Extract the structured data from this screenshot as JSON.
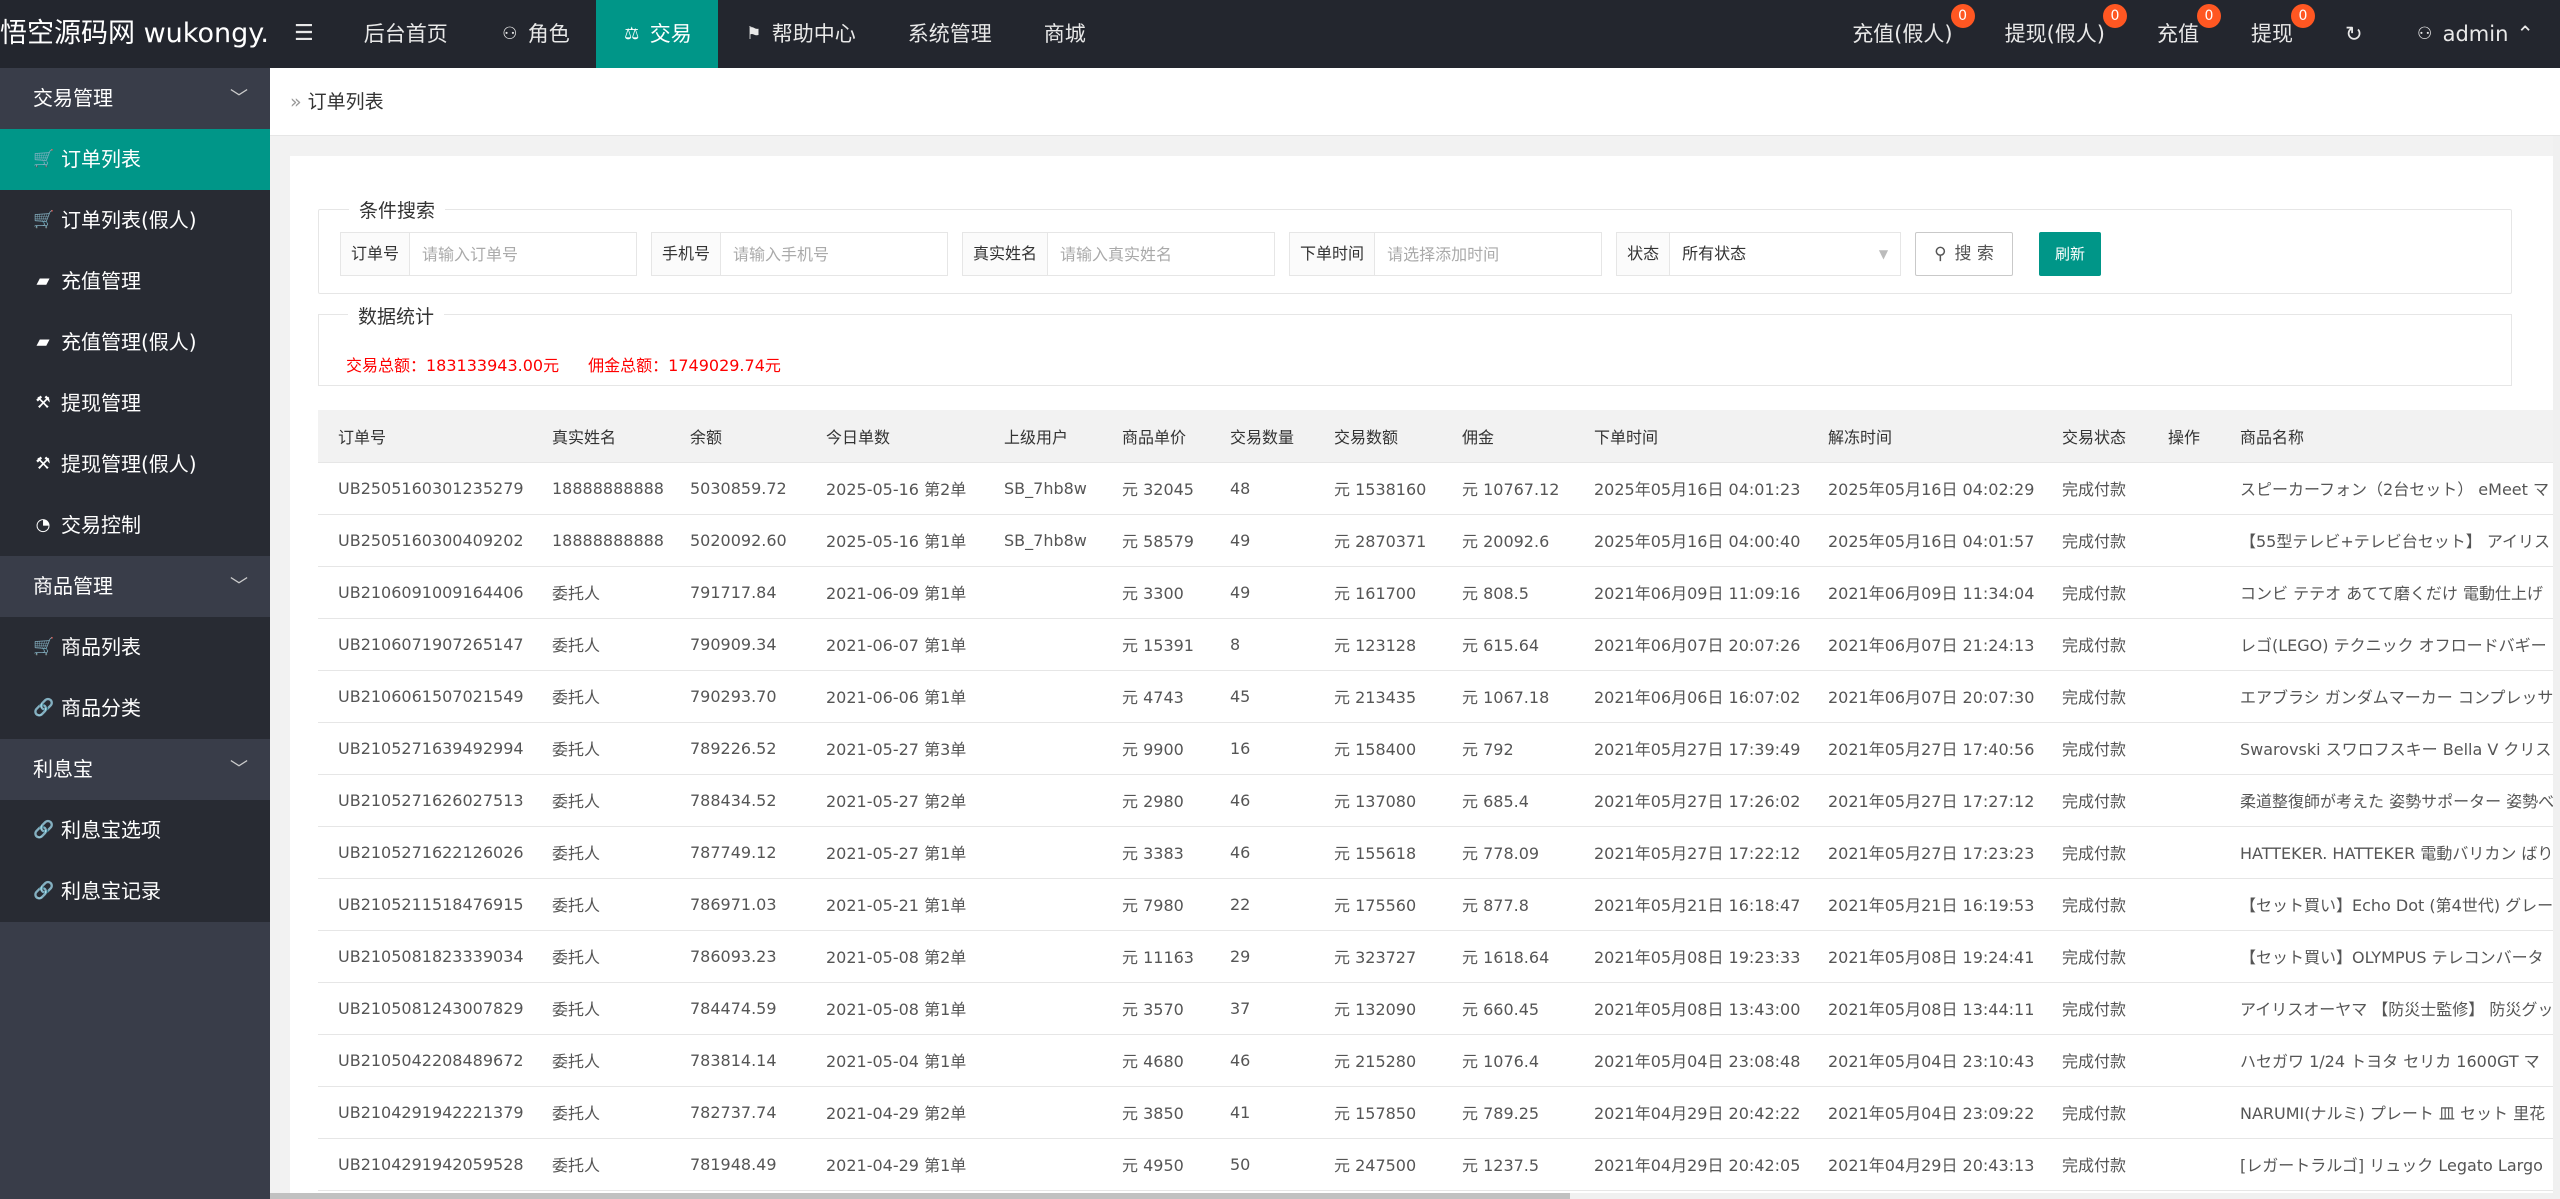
{
  "app": {
    "logo_text": "悟空源码网 wukongy..."
  },
  "topnav": {
    "menu_icon": "hamburger-icon",
    "items": [
      {
        "label": "后台首页",
        "icon": ""
      },
      {
        "label": "角色",
        "icon": "user-icon"
      },
      {
        "label": "交易",
        "icon": "scale-icon"
      },
      {
        "label": "帮助中心",
        "icon": "flag-icon"
      },
      {
        "label": "系统管理",
        "icon": ""
      },
      {
        "label": "商城",
        "icon": ""
      }
    ],
    "active_color": "#009688"
  },
  "topright": {
    "items": [
      {
        "label": "充值(假人)",
        "badge": "0"
      },
      {
        "label": "提现(假人)",
        "badge": "0"
      },
      {
        "label": "充值",
        "badge": "0"
      },
      {
        "label": "提现",
        "badge": "0"
      }
    ],
    "refresh_icon": "refresh-icon",
    "user_label": "admin"
  },
  "sidebar": {
    "groups": [
      {
        "label": "交易管理",
        "items": [
          {
            "label": "订单列表",
            "icon": "cart-icon",
            "active": true
          },
          {
            "label": "订单列表(假人)",
            "icon": "cart-icon"
          },
          {
            "label": "充值管理",
            "icon": "chat-icon"
          },
          {
            "label": "充值管理(假人)",
            "icon": "chat-icon"
          },
          {
            "label": "提现管理",
            "icon": "hammer-icon"
          },
          {
            "label": "提现管理(假人)",
            "icon": "hammer-icon"
          },
          {
            "label": "交易控制",
            "icon": "dashboard-icon"
          }
        ]
      },
      {
        "label": "商品管理",
        "items": [
          {
            "label": "商品列表",
            "icon": "cart-icon"
          },
          {
            "label": "商品分类",
            "icon": "link-icon"
          }
        ]
      },
      {
        "label": "利息宝",
        "items": [
          {
            "label": "利息宝选项",
            "icon": "link-icon"
          },
          {
            "label": "利息宝记录",
            "icon": "link-icon"
          }
        ]
      }
    ]
  },
  "breadcrumb": {
    "label": "订单列表"
  },
  "search": {
    "legend": "条件搜索",
    "order_no_label": "订单号",
    "order_no_placeholder": "请输入订单号",
    "phone_label": "手机号",
    "phone_placeholder": "请输入手机号",
    "realname_label": "真实姓名",
    "realname_placeholder": "请输入真实姓名",
    "time_label": "下单时间",
    "time_placeholder": "请选择添加时间",
    "status_label": "状态",
    "status_value": "所有状态",
    "search_button": "搜 索",
    "refresh_button": "刷新"
  },
  "stats": {
    "legend": "数据统计",
    "total_trade": "交易总额：183133943.00元",
    "total_commission": "佣金总额：1749029.74元"
  },
  "table": {
    "headers": [
      "订单号",
      "真实姓名",
      "余额",
      "今日单数",
      "上级用户",
      "商品单价",
      "交易数量",
      "交易数额",
      "佣金",
      "下单时间",
      "解冻时间",
      "交易状态",
      "操作",
      "商品名称"
    ],
    "rows": [
      [
        "UB2505160301235279",
        "18888888888",
        "5030859.72",
        "2025-05-16 第2单",
        "SB_7hb8w",
        "元 32045",
        "48",
        "元 1538160",
        "元 10767.12",
        "2025年05月16日 04:01:23",
        "2025年05月16日 04:02:29",
        "完成付款",
        "",
        "スピーカーフォン（2台セット） eMeet マ"
      ],
      [
        "UB2505160300409202",
        "18888888888",
        "5020092.60",
        "2025-05-16 第1单",
        "SB_7hb8w",
        "元 58579",
        "49",
        "元 2870371",
        "元 20092.6",
        "2025年05月16日 04:00:40",
        "2025年05月16日 04:01:57",
        "完成付款",
        "",
        "【55型テレビ+テレビ台セット】 アイリス"
      ],
      [
        "UB2106091009164406",
        "委托人",
        "791717.84",
        "2021-06-09 第1单",
        "",
        "元 3300",
        "49",
        "元 161700",
        "元 808.5",
        "2021年06月09日 11:09:16",
        "2021年06月09日 11:34:04",
        "完成付款",
        "",
        "コンビ テテオ あてて磨くだけ 電動仕上げ"
      ],
      [
        "UB2106071907265147",
        "委托人",
        "790909.34",
        "2021-06-07 第1单",
        "",
        "元 15391",
        "8",
        "元 123128",
        "元 615.64",
        "2021年06月07日 20:07:26",
        "2021年06月07日 21:24:13",
        "完成付款",
        "",
        "レゴ(LEGO) テクニック オフロードバギー"
      ],
      [
        "UB2106061507021549",
        "委托人",
        "790293.70",
        "2021-06-06 第1单",
        "",
        "元 4743",
        "45",
        "元 213435",
        "元 1067.18",
        "2021年06月06日 16:07:02",
        "2021年06月07日 20:07:30",
        "完成付款",
        "",
        "エアブラシ ガンダムマーカー コンプレッサ"
      ],
      [
        "UB2105271639492994",
        "委托人",
        "789226.52",
        "2021-05-27 第3单",
        "",
        "元 9900",
        "16",
        "元 158400",
        "元 792",
        "2021年05月27日 17:39:49",
        "2021年05月27日 17:40:56",
        "完成付款",
        "",
        "Swarovski スワロフスキー Bella V クリス"
      ],
      [
        "UB2105271626027513",
        "委托人",
        "788434.52",
        "2021-05-27 第2单",
        "",
        "元 2980",
        "46",
        "元 137080",
        "元 685.4",
        "2021年05月27日 17:26:02",
        "2021年05月27日 17:27:12",
        "完成付款",
        "",
        "柔道整復師が考えた 姿勢サポーター 姿勢べ"
      ],
      [
        "UB2105271622126026",
        "委托人",
        "787749.12",
        "2021-05-27 第1单",
        "",
        "元 3383",
        "46",
        "元 155618",
        "元 778.09",
        "2021年05月27日 17:22:12",
        "2021年05月27日 17:23:23",
        "完成付款",
        "",
        "HATTEKER. HATTEKER 電動バリカン ばり"
      ],
      [
        "UB2105211518476915",
        "委托人",
        "786971.03",
        "2021-05-21 第1单",
        "",
        "元 7980",
        "22",
        "元 175560",
        "元 877.8",
        "2021年05月21日 16:18:47",
        "2021年05月21日 16:19:53",
        "完成付款",
        "",
        "【セット買い】Echo Dot (第4世代) グレー"
      ],
      [
        "UB2105081823339034",
        "委托人",
        "786093.23",
        "2021-05-08 第2单",
        "",
        "元 11163",
        "29",
        "元 323727",
        "元 1618.64",
        "2021年05月08日 19:23:33",
        "2021年05月08日 19:24:41",
        "完成付款",
        "",
        "【セット買い】OLYMPUS テレコンバータ"
      ],
      [
        "UB2105081243007829",
        "委托人",
        "784474.59",
        "2021-05-08 第1单",
        "",
        "元 3570",
        "37",
        "元 132090",
        "元 660.45",
        "2021年05月08日 13:43:00",
        "2021年05月08日 13:44:11",
        "完成付款",
        "",
        "アイリスオーヤマ 【防災士監修】 防災グッ"
      ],
      [
        "UB2105042208489672",
        "委托人",
        "783814.14",
        "2021-05-04 第1单",
        "",
        "元 4680",
        "46",
        "元 215280",
        "元 1076.4",
        "2021年05月04日 23:08:48",
        "2021年05月04日 23:10:43",
        "完成付款",
        "",
        "ハセガワ 1/24 トヨタ セリカ 1600GT マ"
      ],
      [
        "UB2104291942221379",
        "委托人",
        "782737.74",
        "2021-04-29 第2单",
        "",
        "元 3850",
        "41",
        "元 157850",
        "元 789.25",
        "2021年04月29日 20:42:22",
        "2021年05月04日 23:09:22",
        "完成付款",
        "",
        "NARUMI(ナルミ) プレート 皿 セット 里花"
      ],
      [
        "UB2104291942059528",
        "委托人",
        "781948.49",
        "2021-04-29 第1单",
        "",
        "元 4950",
        "50",
        "元 247500",
        "元 1237.5",
        "2021年04月29日 20:42:05",
        "2021年04月29日 20:43:13",
        "完成付款",
        "",
        "[レガートラルゴ] リュック Legato Largo"
      ]
    ]
  }
}
